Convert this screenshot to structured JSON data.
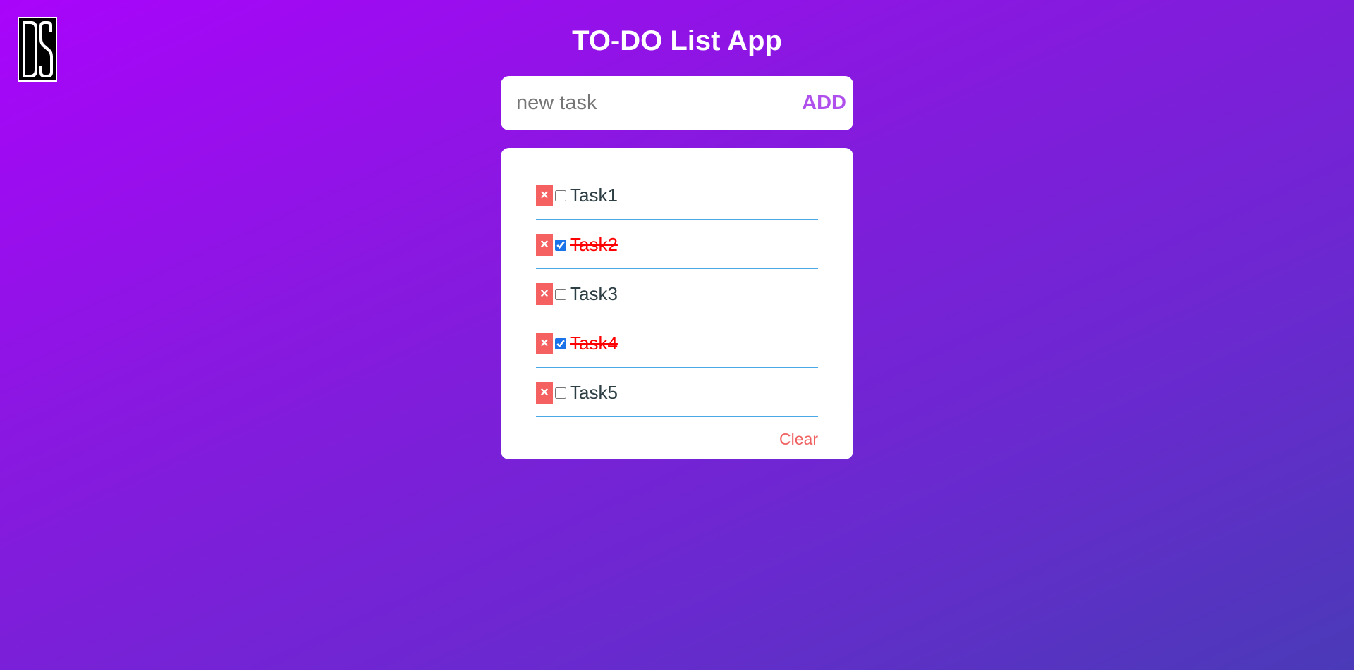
{
  "app": {
    "title": "TO-DO List App",
    "logo_text": "DS"
  },
  "add_form": {
    "placeholder": "new task",
    "value": "",
    "add_label": "ADD"
  },
  "tasks": [
    {
      "label": "Task1",
      "done": false,
      "delete_label": "×"
    },
    {
      "label": "Task2",
      "done": true,
      "delete_label": "×"
    },
    {
      "label": "Task3",
      "done": false,
      "delete_label": "×"
    },
    {
      "label": "Task4",
      "done": true,
      "delete_label": "×"
    },
    {
      "label": "Task5",
      "done": false,
      "delete_label": "×"
    }
  ],
  "clear_label": "Clear",
  "colors": {
    "accent": "#b050ec",
    "delete_button": "#f56060",
    "done_text": "#ff0000",
    "divider": "#4aa8e6",
    "clear_text": "#f06060"
  }
}
